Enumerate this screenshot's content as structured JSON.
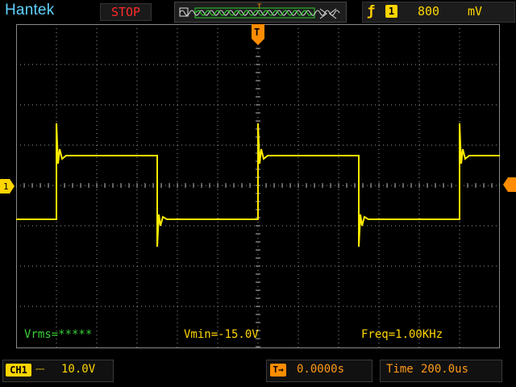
{
  "header": {
    "brand": "Hantek",
    "run_state": "STOP",
    "trigger": {
      "edge_icon": "rising-edge-icon",
      "source": "1",
      "level_value": "800",
      "level_unit": "mV"
    }
  },
  "measurements": {
    "vrms": "Vrms=*****",
    "vmin": "Vmin=-15.0V",
    "freq": "Freq=1.00KHz"
  },
  "footer": {
    "channel_tag": "CH1",
    "coupling_symbol": "⎓",
    "volts_per_div": "10.0V",
    "trigger_pos_icon": "T→",
    "trigger_position": "0.0000s",
    "timebase_label": "Time",
    "timebase": "200.0us"
  },
  "markers": {
    "channel": "1",
    "trigger_top": "T"
  },
  "colors": {
    "trace": "#ffea00",
    "brand": "#5fd2ff",
    "stop": "#ff2a2a",
    "measure_green": "#3ad13a",
    "orange": "#ff8c00"
  }
}
